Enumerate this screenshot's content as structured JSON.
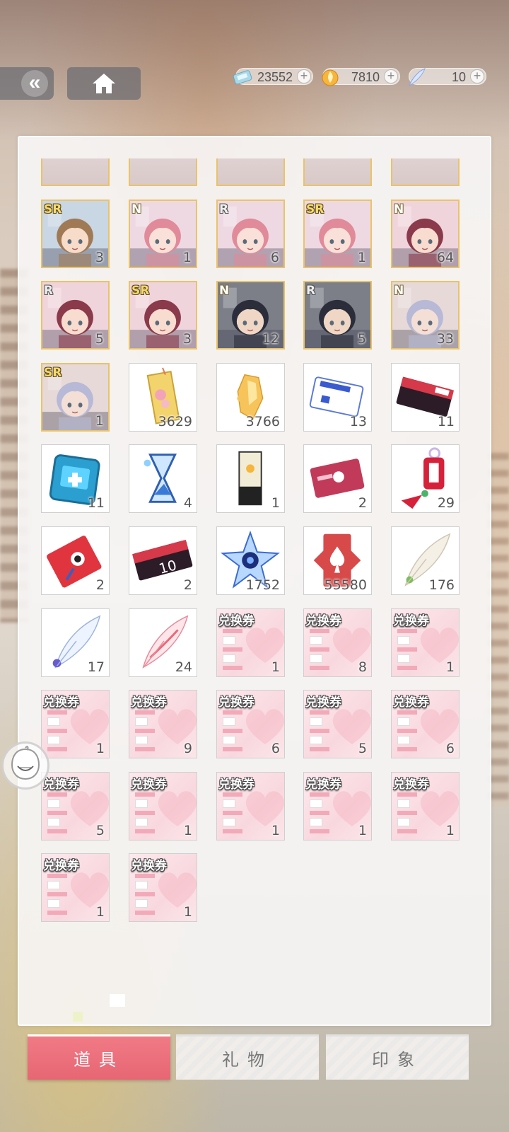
{
  "currencies": [
    {
      "name": "diamond",
      "icon": "crystal-icon",
      "value": "23552"
    },
    {
      "name": "stamina",
      "icon": "fire-orb-icon",
      "value": "7810"
    },
    {
      "name": "feather",
      "icon": "blue-feather-icon",
      "value": "10"
    }
  ],
  "partial_row": [
    "",
    "",
    "",
    "",
    ""
  ],
  "cards": [
    {
      "rarity": "SR",
      "count": "3",
      "char": "brown-hair-boy"
    },
    {
      "rarity": "N",
      "count": "1",
      "char": "pink-hair-girl"
    },
    {
      "rarity": "R",
      "count": "6",
      "char": "pink-hair-girl"
    },
    {
      "rarity": "SR",
      "count": "1",
      "char": "pink-hair-girl"
    },
    {
      "rarity": "N",
      "count": "64",
      "char": "wine-hair-girl"
    },
    {
      "rarity": "R",
      "count": "5",
      "char": "wine-hair-girl"
    },
    {
      "rarity": "SR",
      "count": "3",
      "char": "wine-hair-girl"
    },
    {
      "rarity": "N",
      "count": "12",
      "char": "black-hair-boy"
    },
    {
      "rarity": "R",
      "count": "5",
      "char": "black-hair-boy"
    },
    {
      "rarity": "N",
      "count": "33",
      "char": "silver-hair-boy"
    },
    {
      "rarity": "SR",
      "count": "1",
      "char": "silver-hair-boy"
    }
  ],
  "items": [
    {
      "icon": "sakura-bookmark-icon",
      "count": "3629"
    },
    {
      "icon": "amber-crystal-icon",
      "count": "3766"
    },
    {
      "icon": "blue-ticket-icon",
      "count": "13"
    },
    {
      "icon": "red-ticket-icon",
      "count": "11"
    },
    {
      "icon": "blue-medical-bag-icon",
      "count": "11"
    },
    {
      "icon": "hourglass-icon",
      "count": "4"
    },
    {
      "icon": "light-prism-icon",
      "count": "1"
    },
    {
      "icon": "pink-card-icon",
      "count": "2"
    },
    {
      "icon": "charm-amulet-icon",
      "count": "29"
    },
    {
      "icon": "red-envelope-icon",
      "count": "2"
    },
    {
      "icon": "ten-ticket-icon",
      "count": "2"
    },
    {
      "icon": "blue-star-gem-icon",
      "count": "1752"
    },
    {
      "icon": "spade-card-icon",
      "count": "55580"
    },
    {
      "icon": "white-feather-icon",
      "count": "176"
    },
    {
      "icon": "blue-feather-icon",
      "count": "17"
    },
    {
      "icon": "pink-feather-icon",
      "count": "24"
    }
  ],
  "ticket_label": "兑换券",
  "tickets": [
    "1",
    "8",
    "1",
    "1",
    "9",
    "6",
    "5",
    "6",
    "5",
    "1",
    "1",
    "1",
    "1",
    "1",
    "1"
  ],
  "tabs": [
    {
      "label": "道具",
      "active": true
    },
    {
      "label": "礼物",
      "active": false
    },
    {
      "label": "印象",
      "active": false
    }
  ],
  "colors": {
    "accent": "#e96d79",
    "sr_border": "#e9c36a"
  }
}
